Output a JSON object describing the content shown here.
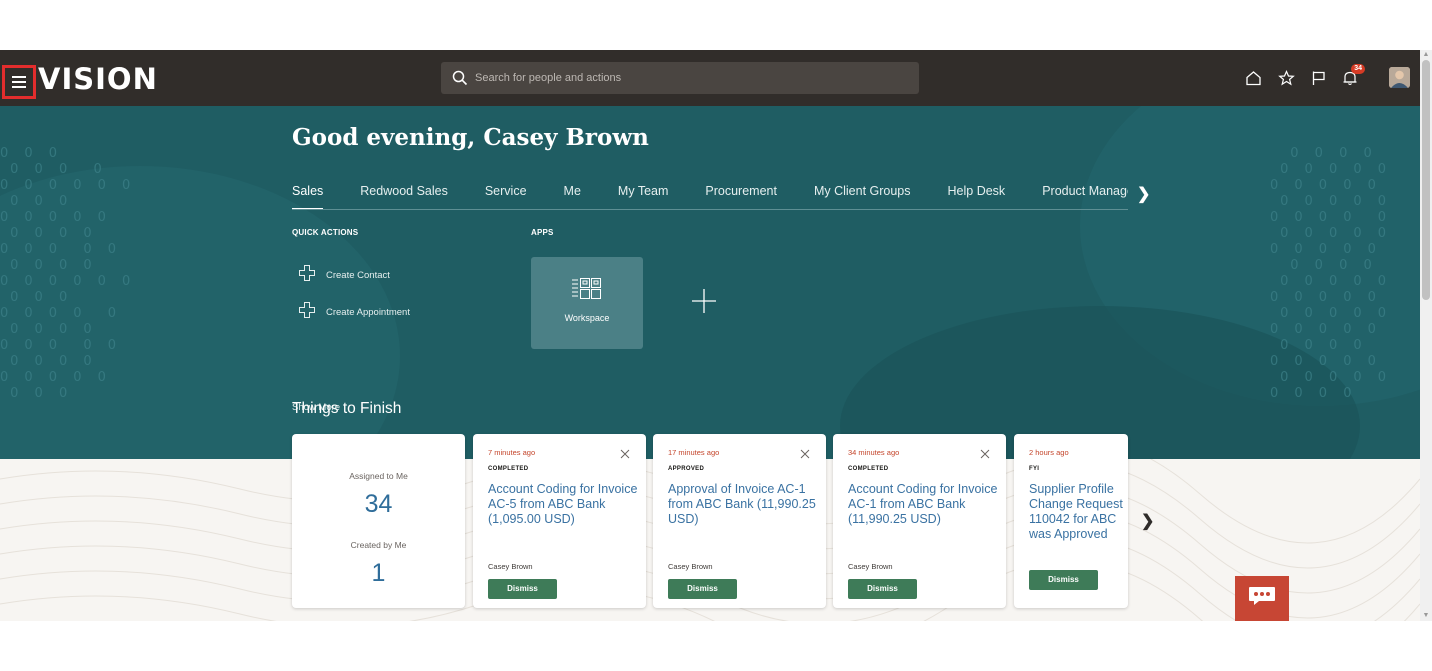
{
  "header": {
    "logo_text": "VISION",
    "search_placeholder": "Search for people and actions",
    "notification_count": "34"
  },
  "hero": {
    "greeting": "Good evening, Casey Brown",
    "tabs": [
      {
        "label": "Sales",
        "active": true
      },
      {
        "label": "Redwood Sales"
      },
      {
        "label": "Service"
      },
      {
        "label": "Me"
      },
      {
        "label": "My Team"
      },
      {
        "label": "Procurement"
      },
      {
        "label": "My Client Groups"
      },
      {
        "label": "Help Desk"
      },
      {
        "label": "Product Management"
      }
    ],
    "quick_actions_label": "QUICK ACTIONS",
    "quick_actions": [
      "Create Contact",
      "Create Appointment"
    ],
    "show_more": "Show More",
    "apps_label": "APPS",
    "apps": [
      "Workspace"
    ]
  },
  "things_to_finish": {
    "title": "Things to Finish",
    "summary": {
      "assigned_label": "Assigned to Me",
      "assigned_count": "34",
      "created_label": "Created by Me",
      "created_count": "1"
    },
    "tasks": [
      {
        "time": "7 minutes ago",
        "status": "COMPLETED",
        "title": "Account Coding for Invoice AC-5 from ABC Bank (1,095.00 USD)",
        "owner": "Casey Brown",
        "action": "Dismiss"
      },
      {
        "time": "17 minutes ago",
        "status": "APPROVED",
        "title": "Approval of Invoice AC-1 from ABC Bank (11,990.25 USD)",
        "owner": "Casey Brown",
        "action": "Dismiss"
      },
      {
        "time": "34 minutes ago",
        "status": "COMPLETED",
        "title": "Account Coding for Invoice AC-1 from ABC Bank (11,990.25 USD)",
        "owner": "Casey Brown",
        "action": "Dismiss"
      },
      {
        "time": "2 hours ago",
        "status": "FYI",
        "title": "Supplier Profile Change Request 110042 for ABC was Approved",
        "owner": "",
        "action": "Dismiss"
      }
    ]
  },
  "colors": {
    "topbar": "#312d2a",
    "hero": "#1f5d63",
    "accent_link": "#3a72a2",
    "dismiss": "#3e7b58",
    "chat": "#c74634",
    "highlight": "#e32d2d"
  },
  "icons": [
    "menu-icon",
    "search-icon",
    "home-icon",
    "star-icon",
    "flag-icon",
    "bell-icon",
    "plus-icon",
    "workspace-icon",
    "close-icon",
    "chevron-right-icon",
    "chat-icon"
  ]
}
